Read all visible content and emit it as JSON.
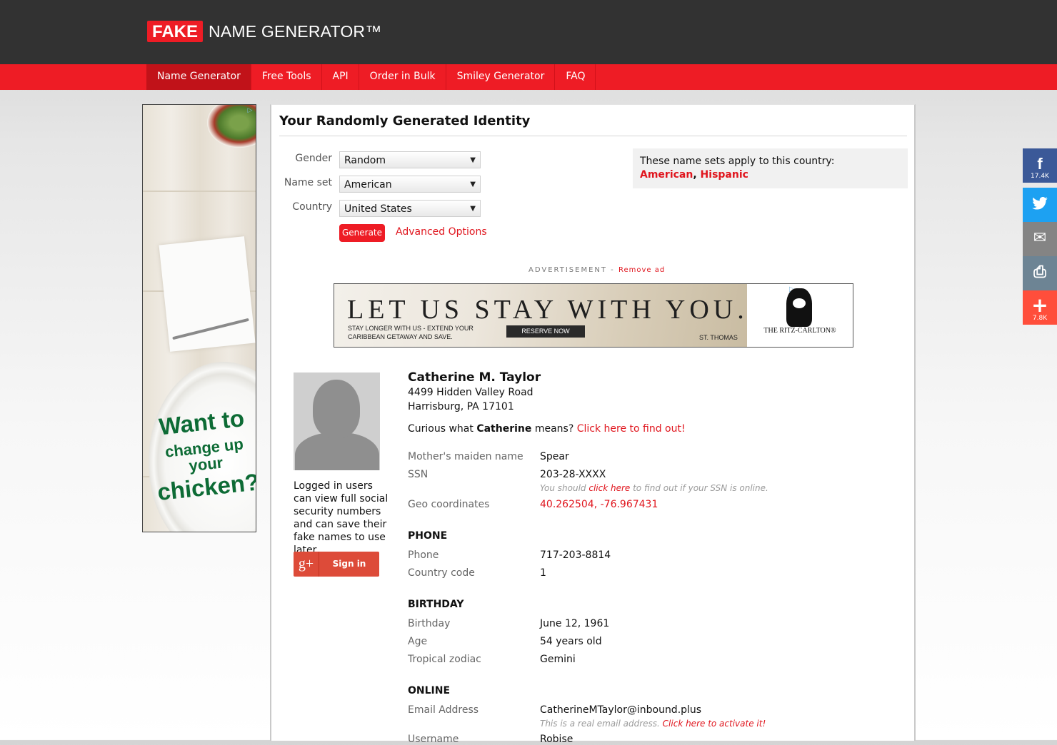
{
  "header": {
    "logo_fake": "FAKE",
    "logo_rest": "NAME GENERATOR™"
  },
  "nav": [
    {
      "label": "Name Generator",
      "active": true
    },
    {
      "label": "Free Tools"
    },
    {
      "label": "API"
    },
    {
      "label": "Order in Bulk"
    },
    {
      "label": "Smiley Generator"
    },
    {
      "label": "FAQ"
    }
  ],
  "left_ad": {
    "line1": "Want to",
    "line2": "change up",
    "line3": "your",
    "line4": "chicken?",
    "adchoice_icon": "adchoices-icon"
  },
  "main": {
    "title": "Your Randomly Generated Identity",
    "form": {
      "gender_label": "Gender",
      "gender_value": "Random",
      "nameset_label": "Name set",
      "nameset_value": "American",
      "country_label": "Country",
      "country_value": "United States",
      "generate_label": "Generate",
      "advanced_label": "Advanced Options"
    },
    "country_info": {
      "text": "These name sets apply to this country:",
      "sets": [
        "American",
        "Hispanic"
      ],
      "separator": ","
    },
    "advertisement": {
      "label": "ADVERTISEMENT - ",
      "remove": "Remove ad",
      "headline": "LET US STAY WITH YOU.",
      "registered": "®",
      "subtext": "STAY LONGER WITH US - EXTEND YOUR CARIBBEAN GETAWAY AND SAVE.",
      "button": "RESERVE NOW",
      "location": "ST. THOMAS",
      "brand": "THE RITZ-CARLTON®"
    }
  },
  "sidebar": {
    "note": "Logged in users can view full social security numbers and can save their fake names to use later.",
    "gplus_icon": "g+",
    "signin": "Sign in"
  },
  "identity": {
    "name": "Catherine M. Taylor",
    "address_line1": "4499 Hidden Valley Road",
    "address_line2": "Harrisburg, PA 17101",
    "curious_prefix": "Curious what ",
    "curious_name": "Catherine",
    "curious_suffix": " means? ",
    "curious_link": "Click here to find out!",
    "maiden_label": "Mother's maiden name",
    "maiden_value": "Spear",
    "ssn_label": "SSN",
    "ssn_value": "203-28-XXXX",
    "ssn_note_prefix": "You should ",
    "ssn_note_link": "click here",
    "ssn_note_suffix": " to find out if your SSN is online.",
    "geo_label": "Geo coordinates",
    "geo_value": "40.262504, -76.967431",
    "phone_section": "PHONE",
    "phone_label": "Phone",
    "phone_value": "717-203-8814",
    "cc_label": "Country code",
    "cc_value": "1",
    "birthday_section": "BIRTHDAY",
    "birthday_label": "Birthday",
    "birthday_value": "June 12, 1961",
    "age_label": "Age",
    "age_value": "54 years old",
    "zodiac_label": "Tropical zodiac",
    "zodiac_value": "Gemini",
    "online_section": "ONLINE",
    "email_label": "Email Address",
    "email_value": "CatherineMTaylor@inbound.plus",
    "email_note_prefix": "This is a real email address. ",
    "email_note_link": "Click here to activate it!",
    "username_label": "Username",
    "username_value": "Robise"
  },
  "share": [
    {
      "icon": "facebook-icon",
      "glyph": "f",
      "count": "17.4K",
      "color": "#3b5998"
    },
    {
      "icon": "twitter-icon",
      "glyph": "🐦",
      "count": "",
      "color": "#1da1f2"
    },
    {
      "icon": "email-icon",
      "glyph": "✉",
      "count": "",
      "color": "#848484"
    },
    {
      "icon": "print-icon",
      "glyph": "⎙",
      "count": "",
      "color": "#6d8494"
    },
    {
      "icon": "more-share-icon",
      "glyph": "+",
      "count": "7.8K",
      "color": "#ff4e3b"
    }
  ],
  "colors": {
    "brand_red": "#ee1c25",
    "link_red": "#e0151d",
    "header_dark": "#323232"
  }
}
